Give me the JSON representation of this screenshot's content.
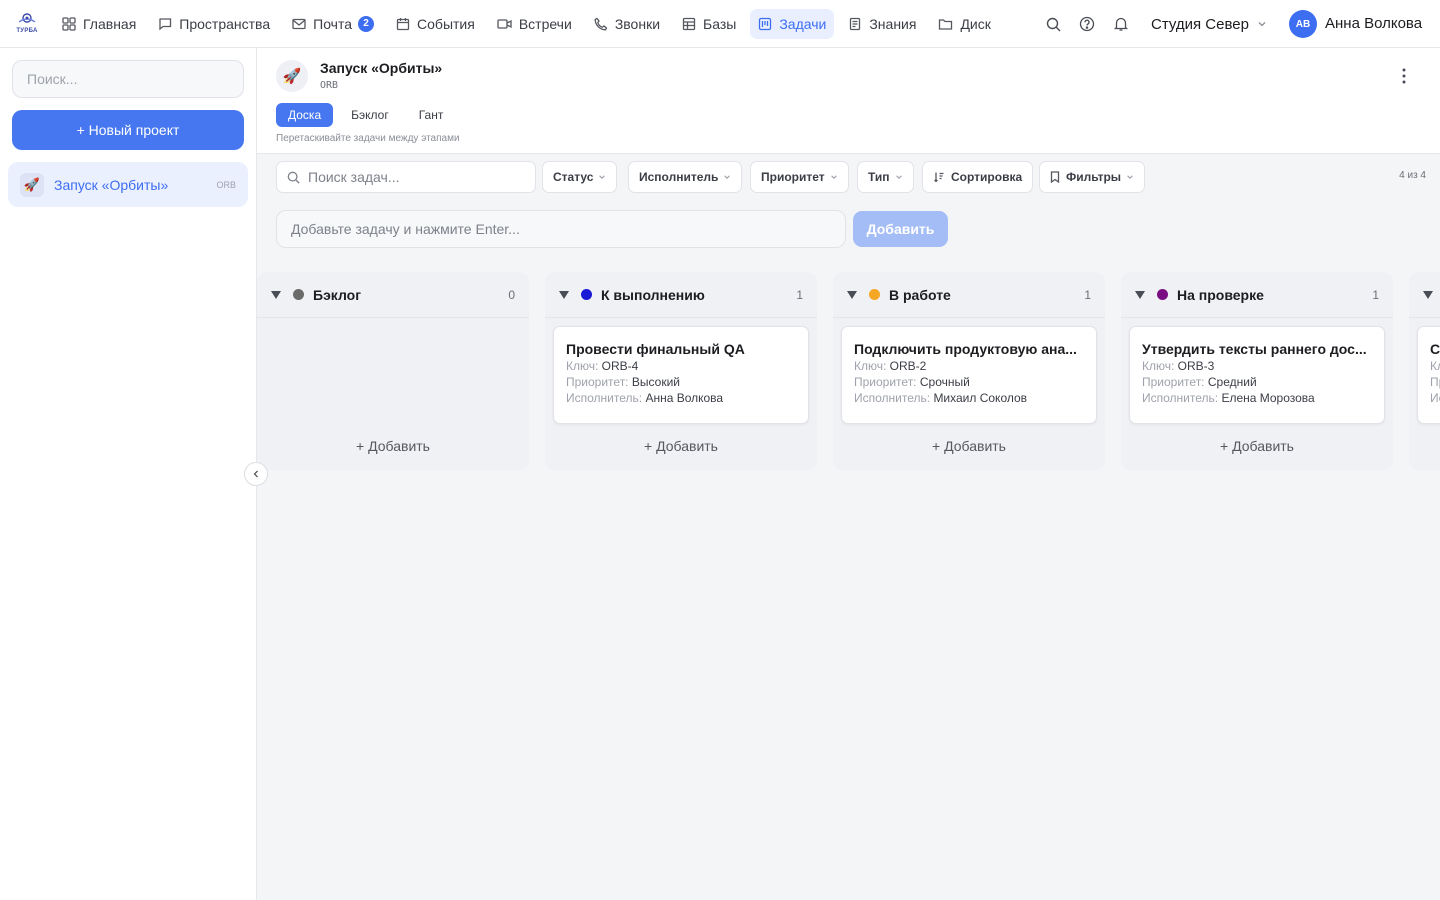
{
  "app": {
    "logo_text": "ТУРБА"
  },
  "nav": {
    "items": [
      {
        "label": "Главная",
        "icon": "grid-icon"
      },
      {
        "label": "Пространства",
        "icon": "chat-icon"
      },
      {
        "label": "Почта",
        "icon": "mail-icon",
        "badge": "2"
      },
      {
        "label": "События",
        "icon": "calendar-icon"
      },
      {
        "label": "Встречи",
        "icon": "video-icon"
      },
      {
        "label": "Звонки",
        "icon": "phone-icon"
      },
      {
        "label": "Базы",
        "icon": "table-icon"
      },
      {
        "label": "Задачи",
        "icon": "kanban-icon",
        "active": true
      },
      {
        "label": "Знания",
        "icon": "book-icon"
      },
      {
        "label": "Диск",
        "icon": "folder-icon"
      }
    ]
  },
  "header": {
    "org": "Студия Север",
    "user_initials": "АВ",
    "user_name": "Анна Волкова"
  },
  "sidebar": {
    "search_placeholder": "Поиск...",
    "new_project_label": "+ Новый проект",
    "projects": [
      {
        "name": "Запуск «Орбиты»",
        "key": "ORB",
        "icon": "🚀"
      }
    ]
  },
  "project": {
    "icon": "🚀",
    "title": "Запуск «Орбиты»",
    "key": "ORB",
    "tabs": [
      {
        "label": "Доска",
        "active": true
      },
      {
        "label": "Бэклог"
      },
      {
        "label": "Гант"
      }
    ],
    "hint": "Перетаскивайте задачи между этапами"
  },
  "toolbar": {
    "search_placeholder": "Поиск задач...",
    "status": "Статус",
    "assignee": "Исполнитель",
    "priority": "Приоритет",
    "type": "Тип",
    "sort": "Сортировка",
    "filters": "Фильтры",
    "count": "4 из 4"
  },
  "quick_add": {
    "placeholder": "Добавьте задачу и нажмите Enter...",
    "button": "Добавить"
  },
  "labels": {
    "key": "Ключ:",
    "priority": "Приоритет:",
    "assignee": "Исполнитель:",
    "add": "+ Добавить"
  },
  "colors": {
    "accent": "#4677f0",
    "backlog": "#6b6b6b",
    "todo": "#1a1ad6",
    "in_progress": "#f5a623",
    "review": "#7a0f84"
  },
  "columns": [
    {
      "title": "Бэклог",
      "count": "0",
      "color": "#6b6b6b",
      "cards": []
    },
    {
      "title": "К выполнению",
      "count": "1",
      "color": "#1a1ad6",
      "cards": [
        {
          "title": "Провести финальный QA",
          "key": "ORB-4",
          "priority": "Высокий",
          "assignee": "Анна Волкова"
        }
      ]
    },
    {
      "title": "В работе",
      "count": "1",
      "color": "#f5a623",
      "cards": [
        {
          "title": "Подключить продуктовую ана...",
          "key": "ORB-2",
          "priority": "Срочный",
          "assignee": "Михаил Соколов"
        }
      ]
    },
    {
      "title": "На проверке",
      "count": "1",
      "color": "#7a0f84",
      "cards": [
        {
          "title": "Утвердить тексты раннего дос...",
          "key": "ORB-3",
          "priority": "Средний",
          "assignee": "Елена Морозова"
        }
      ]
    },
    {
      "title": "",
      "count": "",
      "color": "",
      "cards": [
        {
          "title": "С",
          "key": "",
          "priority": "",
          "assignee": ""
        }
      ]
    }
  ]
}
